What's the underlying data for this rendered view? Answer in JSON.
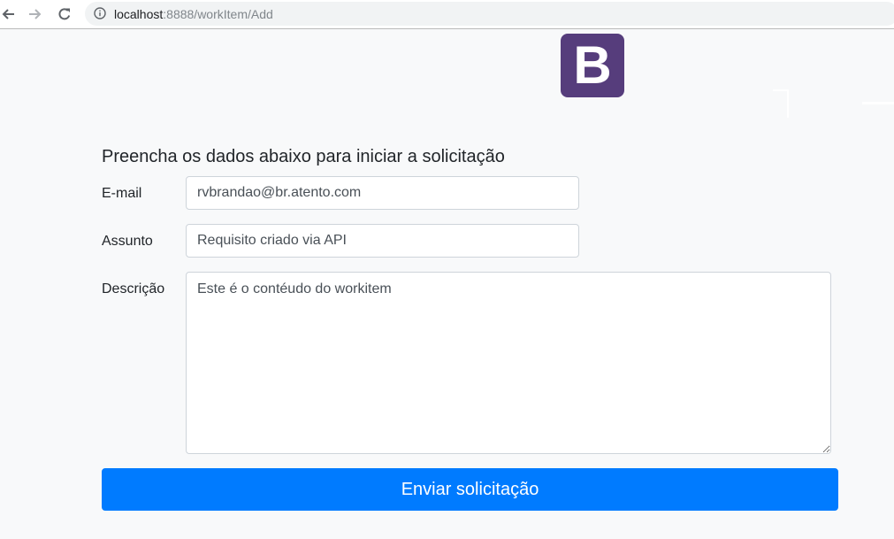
{
  "browser": {
    "url_host": "localhost",
    "url_path": ":8888/workItem/Add",
    "icons": {
      "back": "arrow-left-icon",
      "forward": "arrow-right-icon",
      "reload": "reload-icon",
      "info": "info-icon"
    }
  },
  "page": {
    "logo_letter": "B",
    "logo_color": "#563d7c",
    "background": "#f8f9fa"
  },
  "form": {
    "title": "Preencha os dados abaixo para iniciar a solicitação",
    "email": {
      "label": "E-mail",
      "value": "rvbrandao@br.atento.com"
    },
    "subject": {
      "label": "Assunto",
      "value": "Requisito criado via API"
    },
    "description": {
      "label": "Descrição",
      "value": "Este é o contéudo do workitem"
    },
    "submit_label": "Enviar solicitação",
    "accent_color": "#007bff"
  }
}
